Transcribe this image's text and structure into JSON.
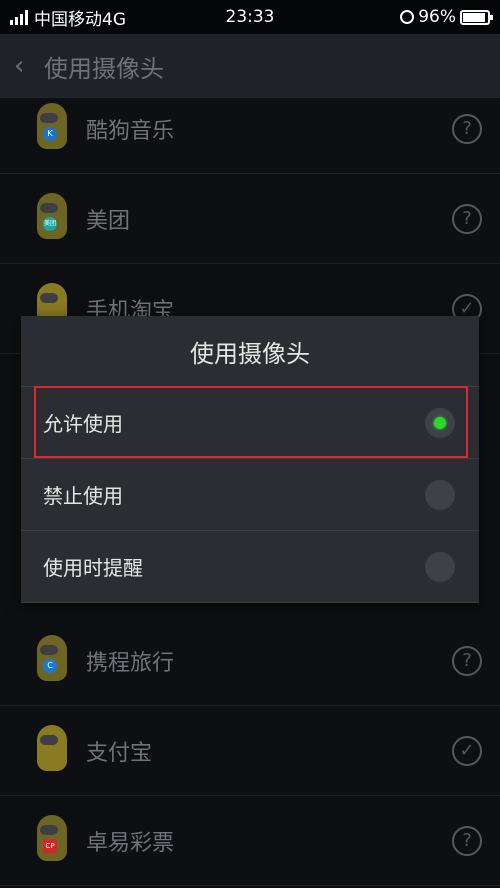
{
  "status_bar": {
    "carrier": "中国移动4G",
    "time": "23:33",
    "battery": "96%"
  },
  "header": {
    "title": "使用摄像头"
  },
  "apps": [
    {
      "name": "酷狗音乐",
      "state": "?",
      "badge_color": "#1c73c9",
      "badge": "K"
    },
    {
      "name": "美团",
      "state": "?",
      "badge_color": "#1aa6a3",
      "badge": "美团"
    },
    {
      "name": "手机淘宝",
      "state": "✓",
      "badge_color": "#c84a1a",
      "badge": ""
    },
    {
      "name": "携程旅行",
      "state": "?",
      "badge_color": "#1a79d1",
      "badge": "C"
    },
    {
      "name": "支付宝",
      "state": "✓",
      "badge_color": "#1a79d1",
      "badge": ""
    },
    {
      "name": "卓易彩票",
      "state": "?",
      "badge_color": "#d4262a",
      "badge": "CP"
    }
  ],
  "dialog": {
    "title": "使用摄像头",
    "options": [
      {
        "label": "允许使用",
        "selected": true
      },
      {
        "label": "禁止使用",
        "selected": false
      },
      {
        "label": "使用时提醒",
        "selected": false
      }
    ]
  }
}
